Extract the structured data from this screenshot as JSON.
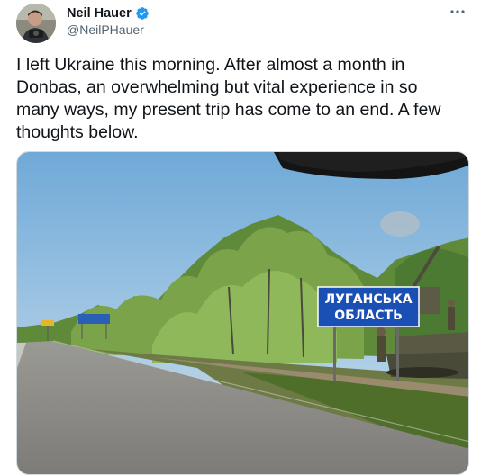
{
  "author": {
    "name": "Neil Hauer",
    "handle": "@NeilPHauer",
    "verified": true,
    "avatar_icon": "profile-photo"
  },
  "tweet": {
    "text": "I left Ukraine this morning. After almost a month in\nDonbas, an overwhelming but vital experience in so\nmany ways, my present trip has come to an end. A few\nthoughts below."
  },
  "media": {
    "sign_line1": "ЛУГАНСЬКА",
    "sign_line2": "ОБЛАСТЬ"
  },
  "icons": {
    "more": "more-options-icon",
    "verified": "verified-badge-icon"
  },
  "colors": {
    "verified_blue": "#1d9bf0",
    "secondary_text": "#536471",
    "sign_blue": "#1a4fb3"
  }
}
